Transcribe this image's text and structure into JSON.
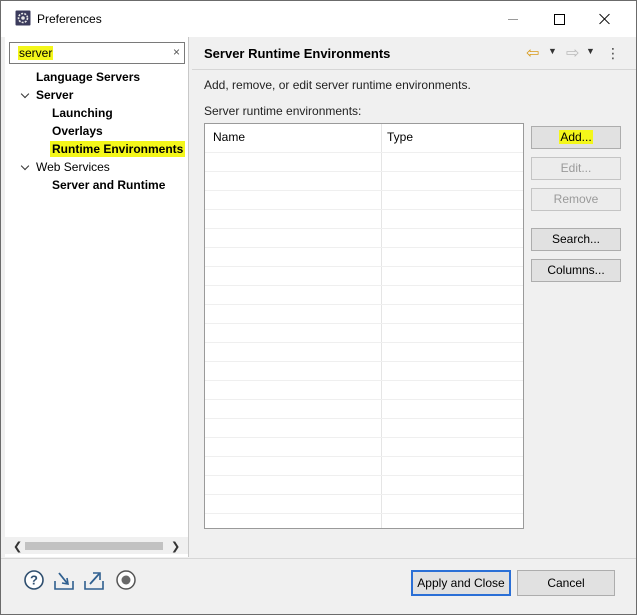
{
  "window": {
    "title": "Preferences"
  },
  "filter": {
    "value": "server",
    "clear_icon": "×"
  },
  "tree": {
    "items": [
      {
        "label": "Language Servers"
      },
      {
        "label": "Server"
      },
      {
        "label": "Launching"
      },
      {
        "label": "Overlays"
      },
      {
        "label": "Runtime Environments"
      },
      {
        "label": "Web Services"
      },
      {
        "label": "Server and Runtime"
      }
    ]
  },
  "page": {
    "title": "Server Runtime Environments",
    "description": "Add, remove, or edit server runtime environments.",
    "list_label": "Server runtime environments:"
  },
  "table": {
    "columns": [
      "Name",
      "Type"
    ],
    "rows": []
  },
  "buttons": {
    "add": "Add...",
    "edit": "Edit...",
    "remove": "Remove",
    "search": "Search...",
    "columns": "Columns..."
  },
  "footer": {
    "apply_close": "Apply and Close",
    "cancel": "Cancel"
  },
  "colors": {
    "highlight": "#f4f71a",
    "default_button_border": "#2a6fd6"
  }
}
